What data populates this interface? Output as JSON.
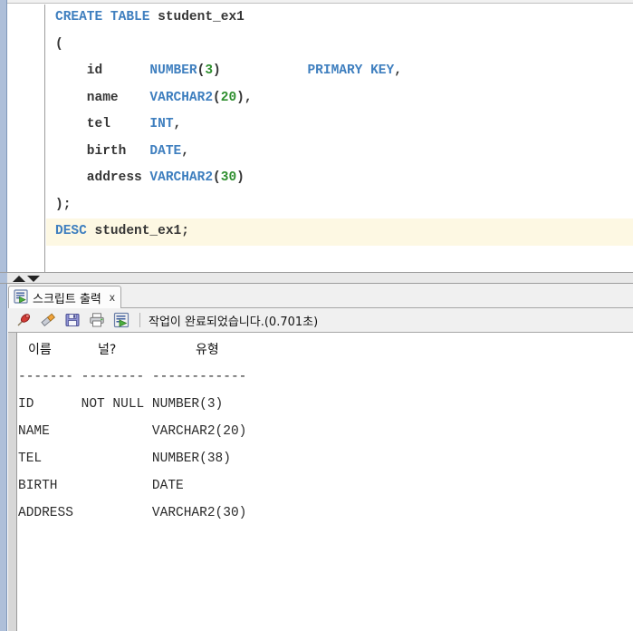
{
  "editor": {
    "name": "sql-worksheet",
    "fold_marker": "minus",
    "current_line_index": 8,
    "lines": [
      {
        "indent": 0,
        "tokens": [
          {
            "t": "kw",
            "v": "CREATE TABLE "
          },
          {
            "t": "id",
            "v": "student_ex1"
          }
        ]
      },
      {
        "indent": 0,
        "tokens": [
          {
            "t": "pun",
            "v": "("
          }
        ]
      },
      {
        "indent": 0,
        "tokens": [
          {
            "t": "id",
            "v": "    id      "
          },
          {
            "t": "kw",
            "v": "NUMBER"
          },
          {
            "t": "pun",
            "v": "("
          },
          {
            "t": "num",
            "v": "3"
          },
          {
            "t": "pun",
            "v": ")"
          },
          {
            "t": "id",
            "v": "           "
          },
          {
            "t": "kw",
            "v": "PRIMARY KEY"
          },
          {
            "t": "pun",
            "v": ","
          }
        ]
      },
      {
        "indent": 0,
        "tokens": [
          {
            "t": "id",
            "v": "    name    "
          },
          {
            "t": "kw",
            "v": "VARCHAR2"
          },
          {
            "t": "pun",
            "v": "("
          },
          {
            "t": "num",
            "v": "20"
          },
          {
            "t": "pun",
            "v": "),"
          }
        ]
      },
      {
        "indent": 0,
        "tokens": [
          {
            "t": "id",
            "v": "    tel     "
          },
          {
            "t": "kw",
            "v": "INT"
          },
          {
            "t": "pun",
            "v": ","
          }
        ]
      },
      {
        "indent": 0,
        "tokens": [
          {
            "t": "id",
            "v": "    birth   "
          },
          {
            "t": "kw",
            "v": "DATE"
          },
          {
            "t": "pun",
            "v": ","
          }
        ]
      },
      {
        "indent": 0,
        "tokens": [
          {
            "t": "id",
            "v": "    address "
          },
          {
            "t": "kw",
            "v": "VARCHAR2"
          },
          {
            "t": "pun",
            "v": "("
          },
          {
            "t": "num",
            "v": "30"
          },
          {
            "t": "pun",
            "v": ")"
          }
        ]
      },
      {
        "indent": 0,
        "tokens": [
          {
            "t": "pun",
            "v": ");"
          }
        ]
      },
      {
        "indent": 0,
        "tokens": [
          {
            "t": "kw",
            "v": "DESC "
          },
          {
            "t": "id",
            "v": "student_ex1;"
          }
        ]
      }
    ],
    "plain_text": "CREATE TABLE student_ex1\n(\n    id      NUMBER(3)           PRIMARY KEY,\n    name    VARCHAR2(20),\n    tel     INT,\n    birth   DATE,\n    address VARCHAR2(30)\n);\nDESC student_ex1;"
  },
  "splitter": {
    "scroll_up_icon": "triangle-up-icon",
    "scroll_down_icon": "triangle-down-icon"
  },
  "output_pane": {
    "tab": {
      "icon": "script-output-icon",
      "label": "스크립트 출력",
      "close_label": "x"
    },
    "toolbar": {
      "buttons": [
        {
          "icon": "pin-icon",
          "label": "고정"
        },
        {
          "icon": "eraser-icon",
          "label": "지우기"
        },
        {
          "icon": "save-icon",
          "label": "저장"
        },
        {
          "icon": "print-icon",
          "label": "인쇄"
        },
        {
          "icon": "script-run-icon",
          "label": "스크립트 실행"
        }
      ],
      "status": "작업이 완료되었습니다.(0.701초)"
    },
    "console": {
      "headers": [
        "이름",
        "널?",
        "유형"
      ],
      "separator": [
        "-------",
        "--------",
        "------------"
      ],
      "rows": [
        {
          "name": "ID",
          "null": "NOT NULL",
          "type": "NUMBER(3)"
        },
        {
          "name": "NAME",
          "null": "",
          "type": "VARCHAR2(20)"
        },
        {
          "name": "TEL",
          "null": "",
          "type": "NUMBER(38)"
        },
        {
          "name": "BIRTH",
          "null": "",
          "type": "DATE"
        },
        {
          "name": "ADDRESS",
          "null": "",
          "type": "VARCHAR2(30)"
        }
      ],
      "plain_text": "이름     널?       유형\n------- -------- ------------\nID      NOT NULL NUMBER(3)\nNAME             VARCHAR2(20)\nTEL              NUMBER(38)\nBIRTH            DATE\nADDRESS          VARCHAR2(30)"
    }
  },
  "colors": {
    "keyword": "#3f7fbf",
    "identifier": "#353535",
    "number": "#2f8f2f",
    "current_line_highlight": "#fdf8e3",
    "rail_blue": "#aebfd9",
    "chrome_gray": "#f0f0f0"
  }
}
